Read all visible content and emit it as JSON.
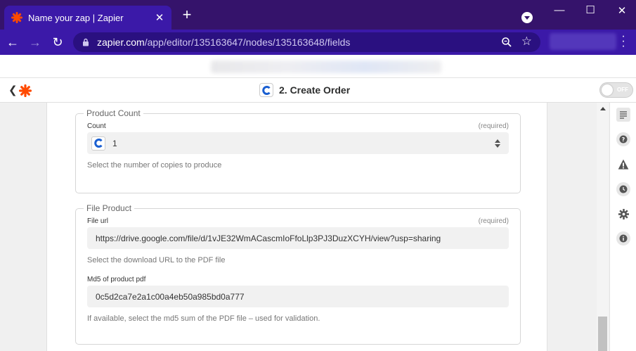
{
  "browser": {
    "tab_title": "Name your zap | Zapier",
    "new_tab": "+",
    "url_host": "zapier.com",
    "url_path": "/app/editor/135163647/nodes/135163648/fields"
  },
  "editor": {
    "step_title": "2. Create Order",
    "toggle_label": "OFF"
  },
  "groups": [
    {
      "legend": "Product Count",
      "fields": [
        {
          "name": "Count",
          "required": "(required)",
          "value": "1",
          "help": "Select the number of copies to produce"
        }
      ]
    },
    {
      "legend": "File Product",
      "fields": [
        {
          "name": "File url",
          "required": "(required)",
          "value": "https://drive.google.com/file/d/1vJE32WmACascmIoFfoLlp3PJ3DuzXCYH/view?usp=sharing",
          "help": "Select the download URL to the PDF file"
        },
        {
          "name": "Md5 of product pdf",
          "value": "0c5d2ca7e2a1c00a4eb50a985bd0a777",
          "help": "If available, select the md5 sum of the PDF file – used for validation."
        }
      ]
    }
  ],
  "colors": {
    "brand_orange": "#ff4a00",
    "tab_active": "#3b19a8",
    "titlebar": "#35136b",
    "cloudprinter_blue": "#1a5fd1"
  },
  "rail_icons": [
    "details-icon",
    "help-icon",
    "warning-icon",
    "history-icon",
    "settings-icon",
    "info-icon"
  ]
}
